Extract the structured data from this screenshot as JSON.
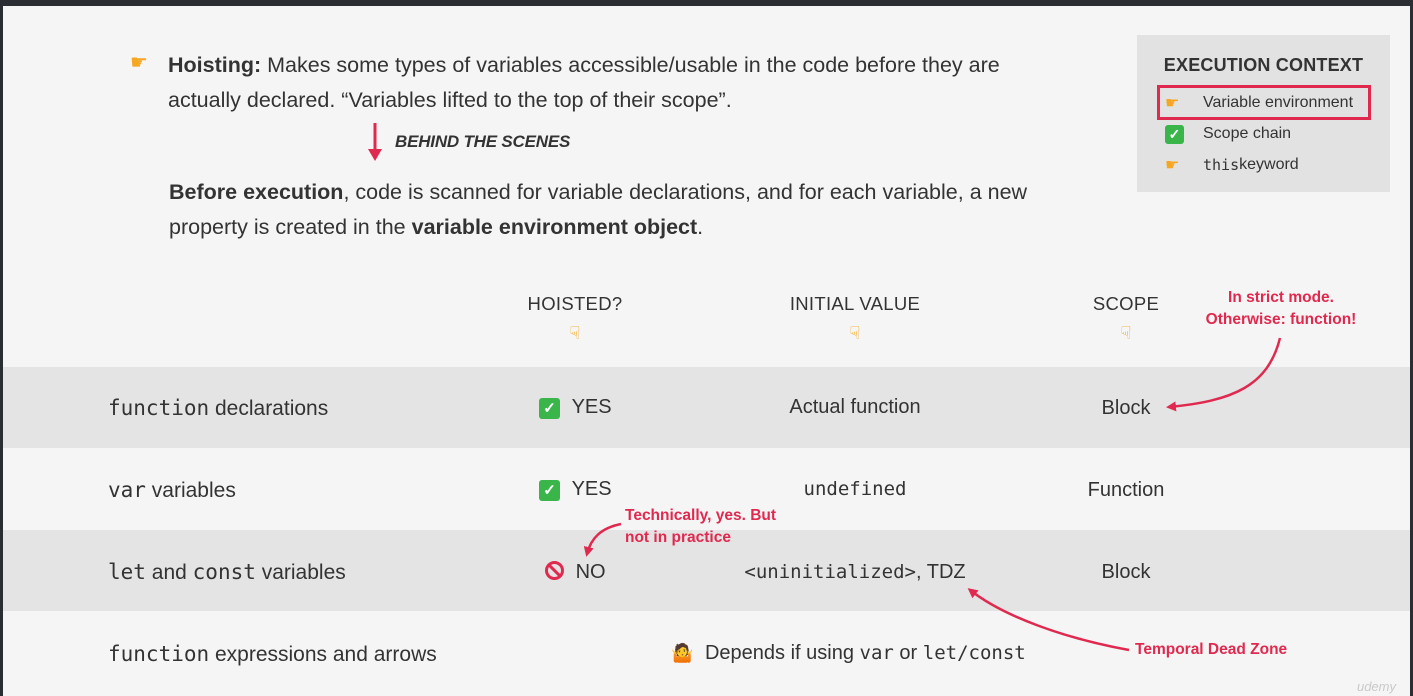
{
  "hoisting": {
    "pointer_icon": "point-right-icon",
    "term": "Hoisting:",
    "definition": " Makes some types of variables accessible/usable in the code before they are actually declared. “Variables lifted to the top of their scope”."
  },
  "behind": {
    "label": "BEHIND THE SCENES"
  },
  "before": {
    "bold1": "Before execution",
    "text1": ", code is scanned for variable declarations, and for each variable, a new property is created in the ",
    "bold2": "variable environment object",
    "text2": "."
  },
  "execution_context": {
    "title": "EXECUTION CONTEXT",
    "items": [
      {
        "icon": "point-right-icon",
        "label": "Variable environment"
      },
      {
        "icon": "check-icon",
        "label": "Scope chain"
      },
      {
        "icon": "point-right-icon",
        "code": "this",
        "label": " keyword"
      }
    ],
    "highlight_color": "#e0294e"
  },
  "table": {
    "headers": [
      "HOISTED?",
      "INITIAL VALUE",
      "SCOPE"
    ],
    "header_icon": "point-down-icon",
    "rows": [
      {
        "code": "function",
        "label": " declarations",
        "hoisted_icon": "check-icon",
        "hoisted": "YES",
        "initial": "Actual function",
        "scope": "Block"
      },
      {
        "code": "var",
        "label": " variables",
        "hoisted_icon": "check-icon",
        "hoisted": "YES",
        "initial_code": "undefined",
        "scope": "Function"
      },
      {
        "code": "let",
        "mid": " and ",
        "code2": "const",
        "label": " variables",
        "hoisted_icon": "no-entry-icon",
        "hoisted": "NO",
        "initial_code": "<uninitialized>",
        "initial_rest": ", TDZ",
        "scope": "Block"
      },
      {
        "code": "function",
        "label": " expressions and arrows",
        "depends_icon": "shrug-icon",
        "depends_text": "Depends if using ",
        "depends_code1": "var",
        "depends_mid": " or ",
        "depends_code2": "let/const"
      }
    ]
  },
  "notes": {
    "strict_line1": "In strict mode.",
    "strict_line2": "Otherwise: function!",
    "technically_line1": "Technically, yes. But",
    "technically_line2": "not in practice",
    "tdz": "Temporal Dead Zone"
  },
  "colors": {
    "accent_red": "#e0294e",
    "row_gray": "#e4e4e4",
    "background": "#f5f5f5",
    "check_green": "#3ab54a",
    "pointer_yellow": "#f5a623"
  },
  "watermark": "udemy"
}
